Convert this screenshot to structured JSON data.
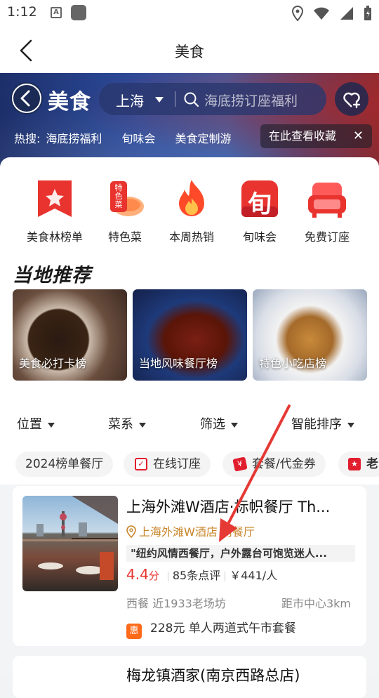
{
  "status_bar": {
    "time": "1:12",
    "a_glyph": "A"
  },
  "title_bar": {
    "title": "美食"
  },
  "hero": {
    "brand": "美食",
    "city": "上海",
    "search_placeholder": "海底捞订座福利",
    "hot_label": "热搜:",
    "hot_items": [
      "海底捞福利",
      "旬味会",
      "美食定制游"
    ],
    "collect_tip": "在此查看收藏",
    "collect_close": "✕"
  },
  "categories": [
    {
      "label": "美食林榜单",
      "icon": "award-ribbon-icon"
    },
    {
      "label": "特色菜",
      "icon": "special-dish-icon",
      "icon_text": "特色菜"
    },
    {
      "label": "本周热销",
      "icon": "flame-icon"
    },
    {
      "label": "旬味会",
      "icon": "xun-badge-icon",
      "icon_text": "旬"
    },
    {
      "label": "免费订座",
      "icon": "sofa-icon"
    }
  ],
  "section_title": "当地推荐",
  "recommendations": [
    {
      "label": "美食必打卡榜"
    },
    {
      "label": "当地风味餐厅榜"
    },
    {
      "label": "特色小吃店榜"
    }
  ],
  "filters": [
    "位置",
    "菜系",
    "筛选",
    "智能排序"
  ],
  "chips": [
    {
      "label": "2024榜单餐厅"
    },
    {
      "label": "在线订座"
    },
    {
      "label": "套餐/代金券"
    },
    {
      "label": "老"
    }
  ],
  "restaurant": {
    "name": "上海外滩W酒店·标帜餐厅 Th...",
    "location": "上海外滩W酒店 内餐厅",
    "quote": "\"纽约风情西餐厅，户外露台可饱览迷人...",
    "score": "4.4",
    "score_unit": "分",
    "reviews": "85条点评",
    "price": "￥441/人",
    "cuisine_area": "西餐 近1933老场坊",
    "distance": "距市中心3km",
    "deal_badge": "惠",
    "deal": "228元 单人两道式午市套餐"
  },
  "next_restaurant": {
    "name": "梅龙镇酒家(南京西路总店)"
  },
  "colors": {
    "accent_red": "#e8332e",
    "location_gold": "#c8852a",
    "arrow_red": "#e53935"
  }
}
